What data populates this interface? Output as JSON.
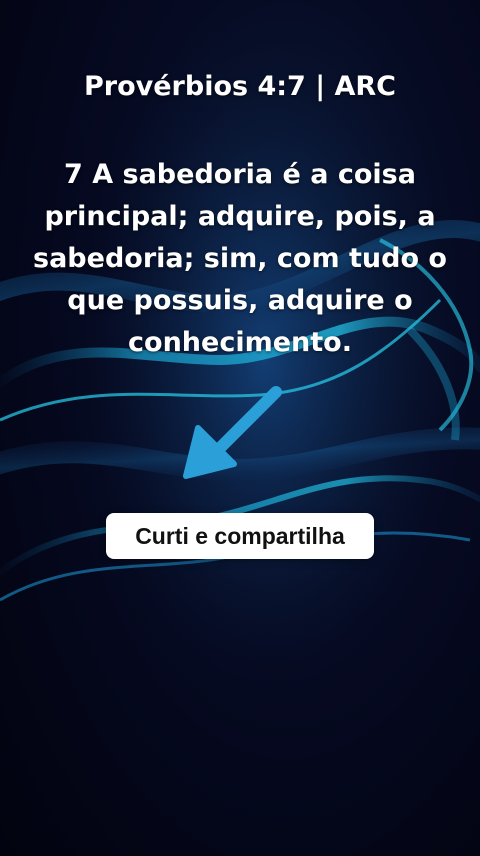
{
  "post": {
    "title": "Provérbios 4:7 | ARC",
    "verse": "7 A sabedoria é a coisa principal; adquire, pois, a sabedoria; sim, com tudo o que possuis, adquire o conhecimento."
  },
  "cta": {
    "label": "Curti e compartilha"
  },
  "icons": {
    "arrow": "arrow-down-left-icon"
  },
  "colors": {
    "background": "#030514",
    "wave_accent": "#22c4e8",
    "arrow": "#2a9fd8",
    "text": "#ffffff",
    "button_bg": "#ffffff",
    "button_text": "#111111"
  }
}
